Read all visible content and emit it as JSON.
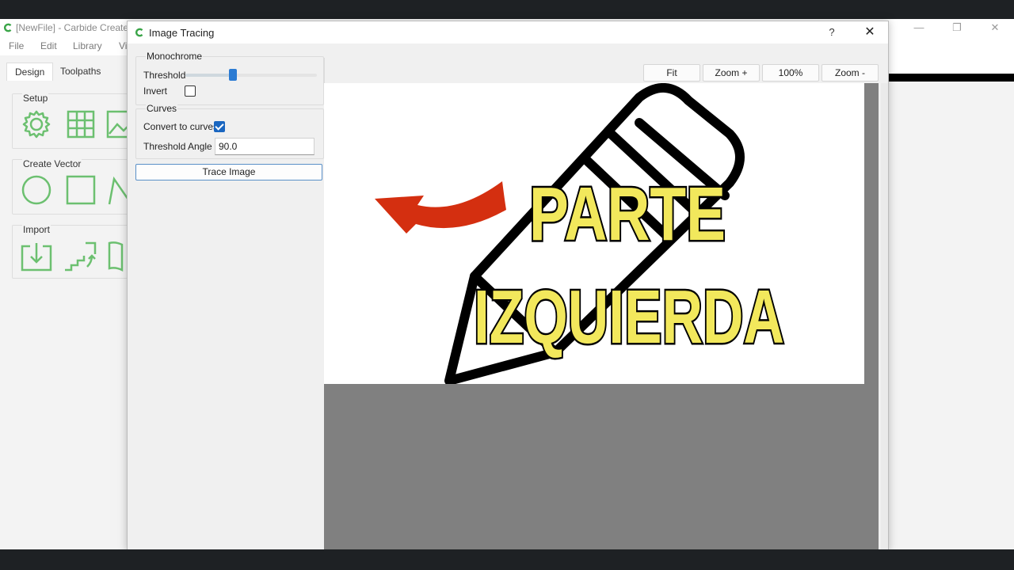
{
  "main_window": {
    "title": "[NewFile] - Carbide Create",
    "controls": {
      "minimize": "—",
      "restore": "❐",
      "close": "✕"
    }
  },
  "menu": [
    "File",
    "Edit",
    "Library",
    "Vi"
  ],
  "tabs": [
    "Design",
    "Toolpaths"
  ],
  "groups": {
    "setup": {
      "label": "Setup",
      "icons": [
        "gear-icon",
        "grid-icon",
        "image-icon"
      ]
    },
    "create_vector": {
      "label": "Create Vector",
      "icons": [
        "circle-icon",
        "rectangle-icon",
        "polyline-icon"
      ]
    },
    "import": {
      "label": "Import",
      "icons": [
        "import-icon",
        "import-stairs-icon",
        "book-icon"
      ]
    }
  },
  "dialog": {
    "title": "Image Tracing",
    "help": "?",
    "close": "✕",
    "monochrome": {
      "title": "Monochrome",
      "threshold_label": "Threshold",
      "threshold_value": 0.36,
      "invert_label": "Invert",
      "invert_checked": false
    },
    "curves": {
      "title": "Curves",
      "convert_label": "Convert to curves",
      "convert_checked": true,
      "angle_label": "Threshold Angle",
      "angle_value": "90.0"
    },
    "trace_button": "Trace Image",
    "zoom_buttons": [
      "Fit",
      "Zoom +",
      "100%",
      "Zoom -"
    ],
    "preview": {
      "line1": "PARTE",
      "line2": "IZQUIERDA"
    }
  },
  "colors": {
    "accent": "#2b7bd3",
    "icon_green": "#6cc070",
    "text_yellow": "#f2e85c",
    "arrow_red": "#d42f10",
    "canvas_gray": "#808080"
  }
}
